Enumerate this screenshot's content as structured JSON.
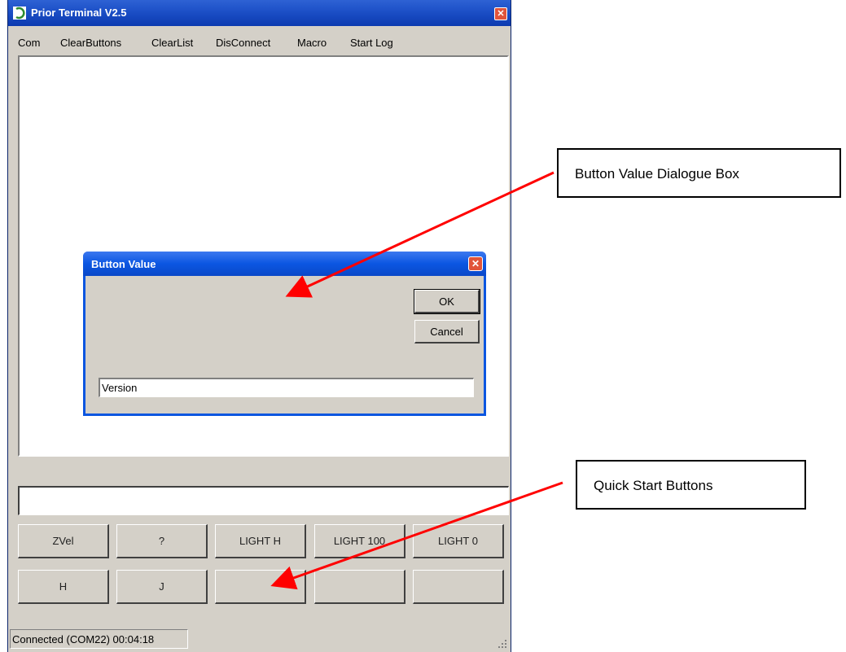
{
  "window": {
    "title": "Prior Terminal V2.5"
  },
  "menu": [
    "Com",
    "ClearButtons",
    "ClearList",
    "DisConnect",
    "Macro",
    "Start Log"
  ],
  "quick_buttons": {
    "row1": [
      "ZVel",
      "?",
      "LIGHT H",
      "LIGHT 100",
      "LIGHT 0"
    ],
    "row2": [
      "H",
      "J",
      "",
      "",
      ""
    ]
  },
  "status": {
    "text": "Connected (COM22) 00:04:18"
  },
  "dialog": {
    "title": "Button Value",
    "ok_label": "OK",
    "cancel_label": "Cancel",
    "input_value": "Version"
  },
  "callouts": {
    "dialog_label": "Button Value Dialogue Box",
    "buttons_label": "Quick Start Buttons"
  },
  "colors": {
    "arrow": "#ff0000",
    "titlebar": "#0a55e0",
    "window_bg": "#d4d0c8"
  }
}
